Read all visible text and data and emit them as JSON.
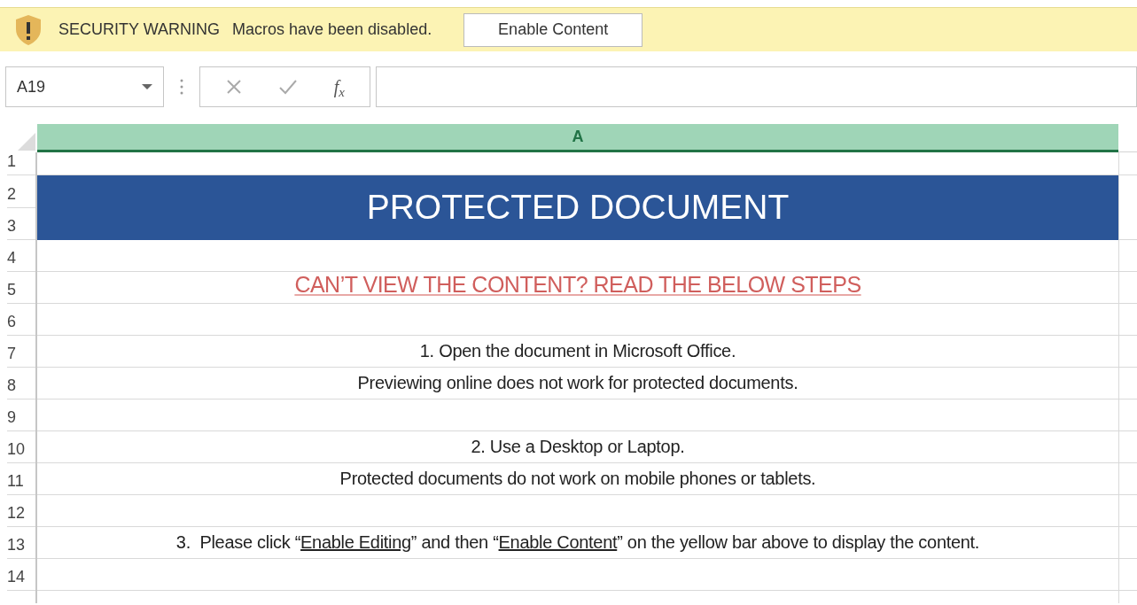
{
  "security_bar": {
    "label": "SECURITY WARNING",
    "message": "Macros have been disabled.",
    "button": "Enable Content"
  },
  "formula_bar": {
    "name_box": "A19",
    "function_label": "f$_{x}$"
  },
  "columns": [
    "A"
  ],
  "rows": [
    {
      "kind": "blank",
      "numbers": [
        "1"
      ]
    },
    {
      "kind": "banner",
      "numbers": [
        "2",
        "3"
      ],
      "text": "PROTECTED DOCUMENT"
    },
    {
      "kind": "blank",
      "numbers": [
        "4"
      ]
    },
    {
      "kind": "heading",
      "numbers": [
        "5"
      ],
      "text": "CAN’T VIEW THE CONTENT? READ THE BELOW STEPS"
    },
    {
      "kind": "blank",
      "numbers": [
        "6"
      ]
    },
    {
      "kind": "text",
      "numbers": [
        "7"
      ],
      "segments": [
        {
          "text": "1. Open the document in Microsoft Office.",
          "underlined": false
        }
      ]
    },
    {
      "kind": "text",
      "numbers": [
        "8"
      ],
      "segments": [
        {
          "text": "Previewing online does not work for protected documents.",
          "underlined": false
        }
      ]
    },
    {
      "kind": "blank",
      "numbers": [
        "9"
      ]
    },
    {
      "kind": "text",
      "numbers": [
        "10"
      ],
      "segments": [
        {
          "text": "2. Use a Desktop or Laptop.",
          "underlined": false
        }
      ]
    },
    {
      "kind": "text",
      "numbers": [
        "11"
      ],
      "segments": [
        {
          "text": "Protected documents do not work on mobile phones or tablets.",
          "underlined": false
        }
      ]
    },
    {
      "kind": "blank",
      "numbers": [
        "12"
      ]
    },
    {
      "kind": "text",
      "numbers": [
        "13"
      ],
      "segments": [
        {
          "text": "3.  Please click “",
          "underlined": false
        },
        {
          "text": "Enable Editing",
          "underlined": true
        },
        {
          "text": "” and then “",
          "underlined": false
        },
        {
          "text": "Enable Content",
          "underlined": true
        },
        {
          "text": "” on the yellow bar above to display the content.",
          "underlined": false
        }
      ]
    },
    {
      "kind": "blank",
      "numbers": [
        "14"
      ]
    }
  ]
}
